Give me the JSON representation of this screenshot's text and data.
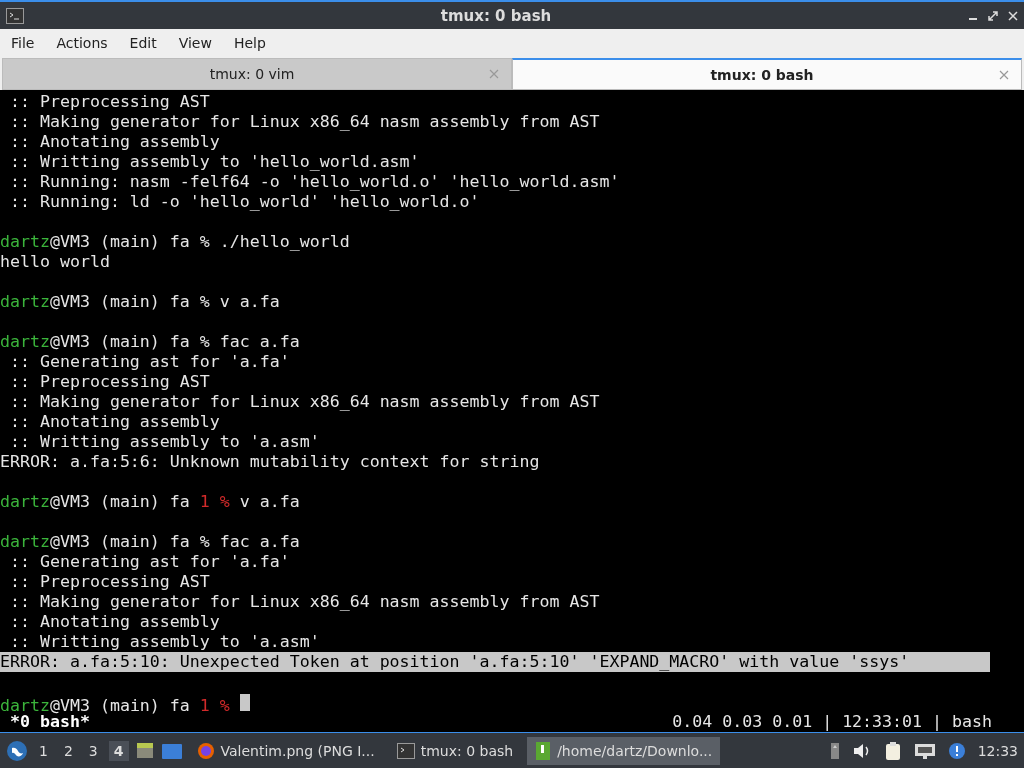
{
  "window": {
    "title": "tmux: 0 bash"
  },
  "menu": [
    "File",
    "Actions",
    "Edit",
    "View",
    "Help"
  ],
  "tabs": [
    {
      "label": "tmux: 0 vim",
      "selected": false
    },
    {
      "label": "tmux: 0 bash",
      "selected": true
    }
  ],
  "terminal": {
    "lines": [
      {
        "kind": "output",
        "text": " :: Preprocessing AST"
      },
      {
        "kind": "output",
        "text": " :: Making generator for Linux x86_64 nasm assembly from AST"
      },
      {
        "kind": "output",
        "text": " :: Anotating assembly"
      },
      {
        "kind": "output",
        "text": " :: Writting assembly to 'hello_world.asm'"
      },
      {
        "kind": "output",
        "text": " :: Running: nasm -felf64 -o 'hello_world.o' 'hello_world.asm'"
      },
      {
        "kind": "output",
        "text": " :: Running: ld -o 'hello_world' 'hello_world.o'"
      },
      {
        "kind": "blank"
      },
      {
        "kind": "prompt",
        "user": "dartz",
        "host": "@VM3 (main) fa",
        "symbol": "%",
        "command": "./hello_world"
      },
      {
        "kind": "output",
        "text": "hello world"
      },
      {
        "kind": "blank"
      },
      {
        "kind": "prompt",
        "user": "dartz",
        "host": "@VM3 (main) fa",
        "symbol": "%",
        "command": "v a.fa"
      },
      {
        "kind": "blank"
      },
      {
        "kind": "prompt",
        "user": "dartz",
        "host": "@VM3 (main) fa",
        "symbol": "%",
        "command": "fac a.fa"
      },
      {
        "kind": "output",
        "text": " :: Generating ast for 'a.fa'"
      },
      {
        "kind": "output",
        "text": " :: Preprocessing AST"
      },
      {
        "kind": "output",
        "text": " :: Making generator for Linux x86_64 nasm assembly from AST"
      },
      {
        "kind": "output",
        "text": " :: Anotating assembly"
      },
      {
        "kind": "output",
        "text": " :: Writting assembly to 'a.asm'"
      },
      {
        "kind": "output",
        "text": "ERROR: a.fa:5:6: Unknown mutability context for string"
      },
      {
        "kind": "blank"
      },
      {
        "kind": "prompt",
        "user": "dartz",
        "host": "@VM3 (main) fa",
        "status": "1",
        "symbol": "%",
        "command": "v a.fa"
      },
      {
        "kind": "blank"
      },
      {
        "kind": "prompt",
        "user": "dartz",
        "host": "@VM3 (main) fa",
        "symbol": "%",
        "command": "fac a.fa"
      },
      {
        "kind": "output",
        "text": " :: Generating ast for 'a.fa'"
      },
      {
        "kind": "output",
        "text": " :: Preprocessing AST"
      },
      {
        "kind": "output",
        "text": " :: Making generator for Linux x86_64 nasm assembly from AST"
      },
      {
        "kind": "output",
        "text": " :: Anotating assembly"
      },
      {
        "kind": "output",
        "text": " :: Writting assembly to 'a.asm'"
      },
      {
        "kind": "highlight",
        "text": "ERROR: a.fa:5:10: Unexpected Token at position 'a.fa:5:10' 'EXPAND_MACRO' with value 'ssys'"
      },
      {
        "kind": "blank"
      },
      {
        "kind": "prompt",
        "user": "dartz",
        "host": "@VM3 (main) fa",
        "status": "1",
        "symbol": "%",
        "cursor": true
      }
    ]
  },
  "tmux_status": {
    "window": " *0 bash*",
    "right": "0.04 0.03 0.01 | 12:33:01 | bash"
  },
  "taskbar": {
    "workspaces": [
      {
        "label": "1",
        "selected": false
      },
      {
        "label": "2",
        "selected": false
      },
      {
        "label": "3",
        "selected": false
      },
      {
        "label": "4",
        "selected": true
      }
    ],
    "tasks": [
      {
        "kind": "browser",
        "label": "Valentim.png (PNG I...",
        "selected": false
      },
      {
        "kind": "terminal",
        "label": "tmux: 0 bash",
        "selected": false
      },
      {
        "kind": "files",
        "label": "/home/dartz/Downlo...",
        "selected": true
      }
    ],
    "clock": "12:33"
  }
}
